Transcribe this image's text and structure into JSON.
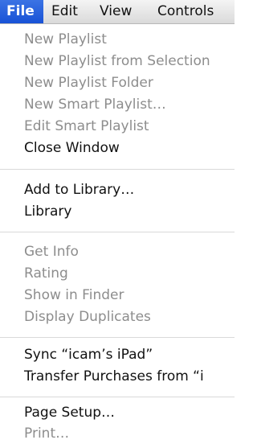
{
  "menubar": {
    "file": "File",
    "edit": "Edit",
    "view": "View",
    "controls": "Controls"
  },
  "menu": {
    "items": [
      {
        "label": "New Playlist",
        "enabled": false
      },
      {
        "label": "New Playlist from Selection",
        "enabled": false
      },
      {
        "label": "New Playlist Folder",
        "enabled": false
      },
      {
        "label": "New Smart Playlist…",
        "enabled": false
      },
      {
        "label": "Edit Smart Playlist",
        "enabled": false
      },
      {
        "label": "Close Window",
        "enabled": true
      },
      {
        "label": "Add to Library…",
        "enabled": true
      },
      {
        "label": "Library",
        "enabled": true
      },
      {
        "label": "Get Info",
        "enabled": false
      },
      {
        "label": "Rating",
        "enabled": false
      },
      {
        "label": "Show in Finder",
        "enabled": false
      },
      {
        "label": "Display Duplicates",
        "enabled": false
      },
      {
        "label": "Sync “icam’s iPad”",
        "enabled": true
      },
      {
        "label": "Transfer Purchases from “i",
        "enabled": true
      },
      {
        "label": "Page Setup…",
        "enabled": true
      },
      {
        "label": "Print…",
        "enabled": false
      }
    ]
  },
  "colors": {
    "menubar_selected": "#1852d6",
    "enabled_text": "#111111",
    "disabled_text": "#8d8d8d"
  }
}
